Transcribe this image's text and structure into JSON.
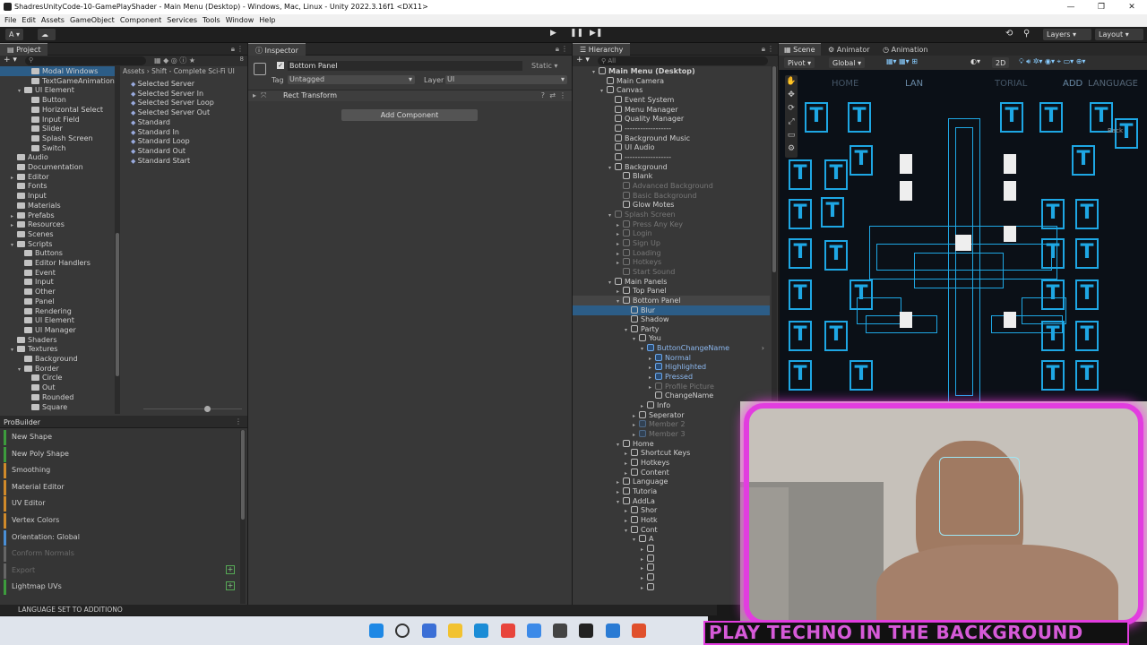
{
  "window": {
    "title": "ShadresUnityCode-10-GamePlayShader - Main Menu (Desktop) - Windows, Mac, Linux - Unity 2022.3.16f1 <DX11>",
    "controls": [
      "—",
      "❐",
      "✕"
    ]
  },
  "menu": [
    "File",
    "Edit",
    "Assets",
    "GameObject",
    "Component",
    "Services",
    "Tools",
    "Window",
    "Help"
  ],
  "toolbar": {
    "account": "A ▾",
    "layers": "Layers",
    "layout": "Layout"
  },
  "project": {
    "tab": "Project",
    "breadcrumb": "Assets › Shift - Complete Sci-Fi UI",
    "count": "8",
    "tree": [
      {
        "d": 3,
        "t": "Modal Windows",
        "sel": true
      },
      {
        "d": 3,
        "t": "TextGameAnimation"
      },
      {
        "d": 2,
        "t": "UI Element",
        "open": true
      },
      {
        "d": 3,
        "t": "Button"
      },
      {
        "d": 3,
        "t": "Horizontal Select"
      },
      {
        "d": 3,
        "t": "Input Field"
      },
      {
        "d": 3,
        "t": "Slider"
      },
      {
        "d": 3,
        "t": "Splash Screen"
      },
      {
        "d": 3,
        "t": "Switch"
      },
      {
        "d": 1,
        "t": "Audio"
      },
      {
        "d": 1,
        "t": "Documentation"
      },
      {
        "d": 1,
        "t": "Editor",
        "arrow": true
      },
      {
        "d": 1,
        "t": "Fonts"
      },
      {
        "d": 1,
        "t": "Input"
      },
      {
        "d": 1,
        "t": "Materials"
      },
      {
        "d": 1,
        "t": "Prefabs",
        "arrow": true
      },
      {
        "d": 1,
        "t": "Resources",
        "arrow": true
      },
      {
        "d": 1,
        "t": "Scenes"
      },
      {
        "d": 1,
        "t": "Scripts",
        "open": true
      },
      {
        "d": 2,
        "t": "Buttons"
      },
      {
        "d": 2,
        "t": "Editor Handlers"
      },
      {
        "d": 2,
        "t": "Event"
      },
      {
        "d": 2,
        "t": "Input"
      },
      {
        "d": 2,
        "t": "Other"
      },
      {
        "d": 2,
        "t": "Panel"
      },
      {
        "d": 2,
        "t": "Rendering"
      },
      {
        "d": 2,
        "t": "UI Element"
      },
      {
        "d": 2,
        "t": "UI Manager"
      },
      {
        "d": 1,
        "t": "Shaders"
      },
      {
        "d": 1,
        "t": "Textures",
        "open": true
      },
      {
        "d": 2,
        "t": "Background"
      },
      {
        "d": 2,
        "t": "Border",
        "open": true
      },
      {
        "d": 3,
        "t": "Circle"
      },
      {
        "d": 3,
        "t": "Out"
      },
      {
        "d": 3,
        "t": "Rounded"
      },
      {
        "d": 3,
        "t": "Square"
      }
    ],
    "files": [
      "Selected Server",
      "Selected Server In",
      "Selected Server Loop",
      "Selected Server Out",
      "Standard",
      "Standard In",
      "Standard Loop",
      "Standard Out",
      "Standard Start"
    ]
  },
  "probuilder": {
    "tab": "ProBuilder",
    "items": [
      {
        "t": "New Shape",
        "c": "#3d9c3d"
      },
      {
        "t": "New Poly Shape",
        "c": "#3d9c3d"
      },
      {
        "t": "Smoothing",
        "c": "#d08a2a"
      },
      {
        "t": "Material Editor",
        "c": "#d08a2a"
      },
      {
        "t": "UV Editor",
        "c": "#d08a2a"
      },
      {
        "t": "Vertex Colors",
        "c": "#d08a2a"
      },
      {
        "t": "Orientation: Global",
        "c": "#4a8fd6"
      },
      {
        "t": "Conform Normals",
        "c": "#666",
        "dim": true
      },
      {
        "t": "Export",
        "c": "#666",
        "dim": true,
        "plus": true
      },
      {
        "t": "Lightmap UVs",
        "c": "#3d9c3d",
        "plus": true
      }
    ]
  },
  "inspector": {
    "tab": "Inspector",
    "object_name": "Bottom Panel",
    "static_label": "Static",
    "tag_label": "Tag",
    "tag_value": "Untagged",
    "layer_label": "Layer",
    "layer_value": "UI",
    "component": "Rect Transform",
    "add_component": "Add Component"
  },
  "hierarchy": {
    "tab": "Hierarchy",
    "search": "All",
    "rows": [
      {
        "d": 0,
        "t": "Main Menu (Desktop)",
        "bold": true,
        "open": true
      },
      {
        "d": 1,
        "t": "Main Camera"
      },
      {
        "d": 1,
        "t": "Canvas",
        "open": true
      },
      {
        "d": 2,
        "t": "Event System"
      },
      {
        "d": 2,
        "t": "Menu Manager"
      },
      {
        "d": 2,
        "t": "Quality Manager"
      },
      {
        "d": 2,
        "t": "------------------"
      },
      {
        "d": 2,
        "t": "Background Music"
      },
      {
        "d": 2,
        "t": "UI Audio"
      },
      {
        "d": 2,
        "t": "------------------"
      },
      {
        "d": 2,
        "t": "Background",
        "open": true
      },
      {
        "d": 3,
        "t": "Blank"
      },
      {
        "d": 3,
        "t": "Advanced Background",
        "dim": true
      },
      {
        "d": 3,
        "t": "Basic Background",
        "dim": true
      },
      {
        "d": 3,
        "t": "Glow Motes"
      },
      {
        "d": 2,
        "t": "Splash Screen",
        "dim": true,
        "open": true
      },
      {
        "d": 3,
        "t": "Press Any Key",
        "dim": true,
        "arrow": true
      },
      {
        "d": 3,
        "t": "Login",
        "dim": true,
        "arrow": true
      },
      {
        "d": 3,
        "t": "Sign Up",
        "dim": true,
        "arrow": true
      },
      {
        "d": 3,
        "t": "Loading",
        "dim": true,
        "arrow": true
      },
      {
        "d": 3,
        "t": "Hotkeys",
        "dim": true,
        "arrow": true
      },
      {
        "d": 3,
        "t": "Start Sound",
        "dim": true
      },
      {
        "d": 2,
        "t": "Main Panels",
        "open": true
      },
      {
        "d": 3,
        "t": "Top Panel",
        "arrow": true
      },
      {
        "d": 3,
        "t": "Bottom Panel",
        "open": true,
        "hover": true
      },
      {
        "d": 4,
        "t": "Blur",
        "sel": true
      },
      {
        "d": 4,
        "t": "Shadow"
      },
      {
        "d": 4,
        "t": "Party",
        "open": true
      },
      {
        "d": 5,
        "t": "You",
        "open": true
      },
      {
        "d": 6,
        "t": "ButtonChangeName",
        "blue": true,
        "open": true,
        "chev": true
      },
      {
        "d": 7,
        "t": "Normal",
        "blue": true,
        "arrow": true
      },
      {
        "d": 7,
        "t": "Highlighted",
        "blue": true,
        "arrow": true
      },
      {
        "d": 7,
        "t": "Pressed",
        "blue": true,
        "arrow": true
      },
      {
        "d": 7,
        "t": "Profile Picture",
        "dim": true,
        "arrow": true
      },
      {
        "d": 7,
        "t": "ChangeName"
      },
      {
        "d": 6,
        "t": "Info",
        "arrow": true
      },
      {
        "d": 5,
        "t": "Seperator",
        "arrow": true
      },
      {
        "d": 5,
        "t": "Member 2",
        "dim": true,
        "blue": true,
        "arrow": true
      },
      {
        "d": 5,
        "t": "Member 3",
        "dim": true,
        "blue": true,
        "arrow": true
      },
      {
        "d": 3,
        "t": "Home",
        "open": true
      },
      {
        "d": 4,
        "t": "Shortcut Keys",
        "arrow": true
      },
      {
        "d": 4,
        "t": "Hotkeys",
        "arrow": true
      },
      {
        "d": 4,
        "t": "Content",
        "arrow": true
      },
      {
        "d": 3,
        "t": "Language",
        "arrow": true
      },
      {
        "d": 3,
        "t": "Tutoria",
        "arrow": true
      },
      {
        "d": 3,
        "t": "AddLa",
        "open": true
      },
      {
        "d": 4,
        "t": "Shor",
        "arrow": true
      },
      {
        "d": 4,
        "t": "Hotk",
        "arrow": true
      },
      {
        "d": 4,
        "t": "Cont",
        "open": true
      },
      {
        "d": 5,
        "t": "A",
        "open": true
      },
      {
        "d": 6,
        "t": "",
        "arrow": true
      },
      {
        "d": 6,
        "t": "",
        "arrow": true
      },
      {
        "d": 6,
        "t": "",
        "arrow": true
      },
      {
        "d": 6,
        "t": "",
        "arrow": true
      },
      {
        "d": 6,
        "t": "",
        "arrow": true
      }
    ]
  },
  "scene": {
    "tabs": [
      "Scene",
      "Animator",
      "Animation"
    ],
    "pivot": "Pivot",
    "global": "Global",
    "mode2d": "2D",
    "overlay_labels": [
      "HOME",
      "LAN",
      "TORIAL",
      "ADD",
      "LANGUAGE",
      "Back"
    ]
  },
  "status": {
    "text": "LANGUAGE SET TO ADDITIONO"
  },
  "banner": {
    "text": "PLAY TECHNO IN THE BACKGROUND"
  },
  "taskbar": {
    "icons": [
      "windows-start",
      "search",
      "store",
      "explorer",
      "edge",
      "chrome",
      "chrome-alt",
      "unity-hub",
      "unity",
      "vscode",
      "brave"
    ]
  }
}
